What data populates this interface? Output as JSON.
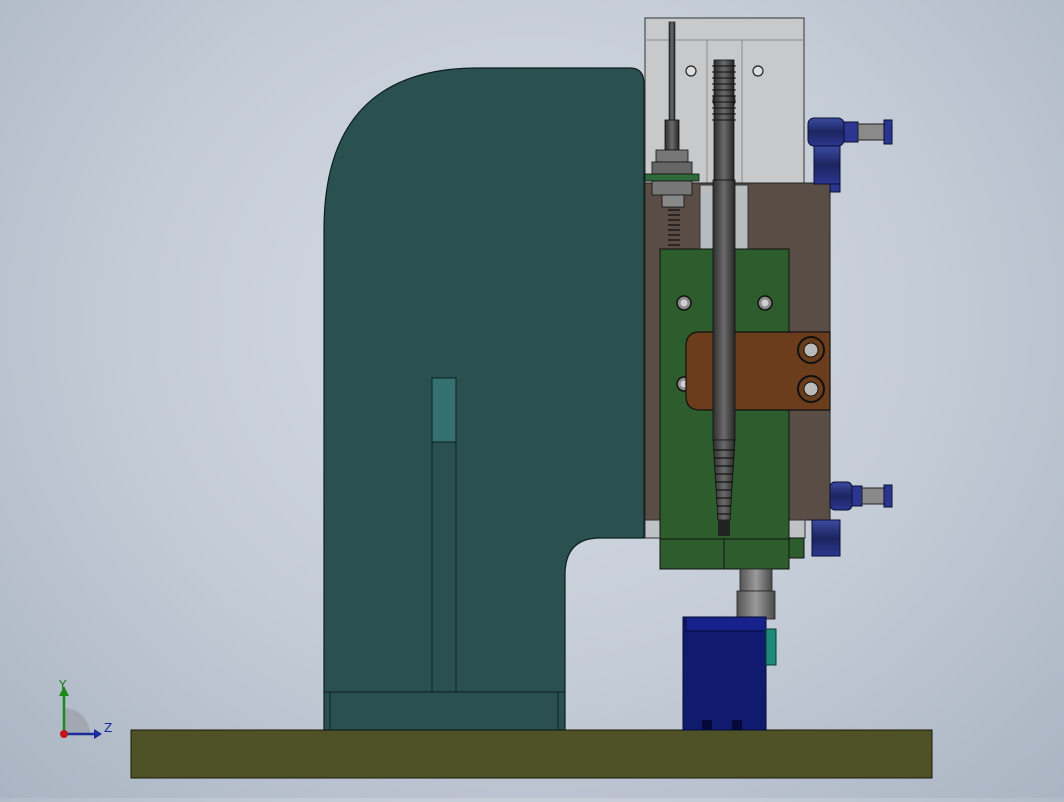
{
  "viewport": {
    "background_top": "#d7dde6",
    "background_bottom": "#aab4c2"
  },
  "model": {
    "parts": [
      {
        "name": "base-plate",
        "color": "#4f5227"
      },
      {
        "name": "c-frame-body",
        "color": "#2a5050"
      },
      {
        "name": "cylinder-head-block",
        "color": "#c7c9cb"
      },
      {
        "name": "mounting-block",
        "color": "#5a4d45"
      },
      {
        "name": "slide-plate",
        "color": "#2d5c2d"
      },
      {
        "name": "clamp-bracket",
        "color": "#6b3d1c"
      },
      {
        "name": "pressing-die",
        "color": "#101a6e"
      },
      {
        "name": "air-fitting",
        "color": "#1f2a64"
      },
      {
        "name": "adjust-rod",
        "color": "#3a3a3a"
      }
    ]
  },
  "triad": {
    "y_label": "Y",
    "z_label": "Z",
    "y_color": "#1b8a1b",
    "z_color": "#1a2a9a",
    "x_color": "#c01818"
  }
}
